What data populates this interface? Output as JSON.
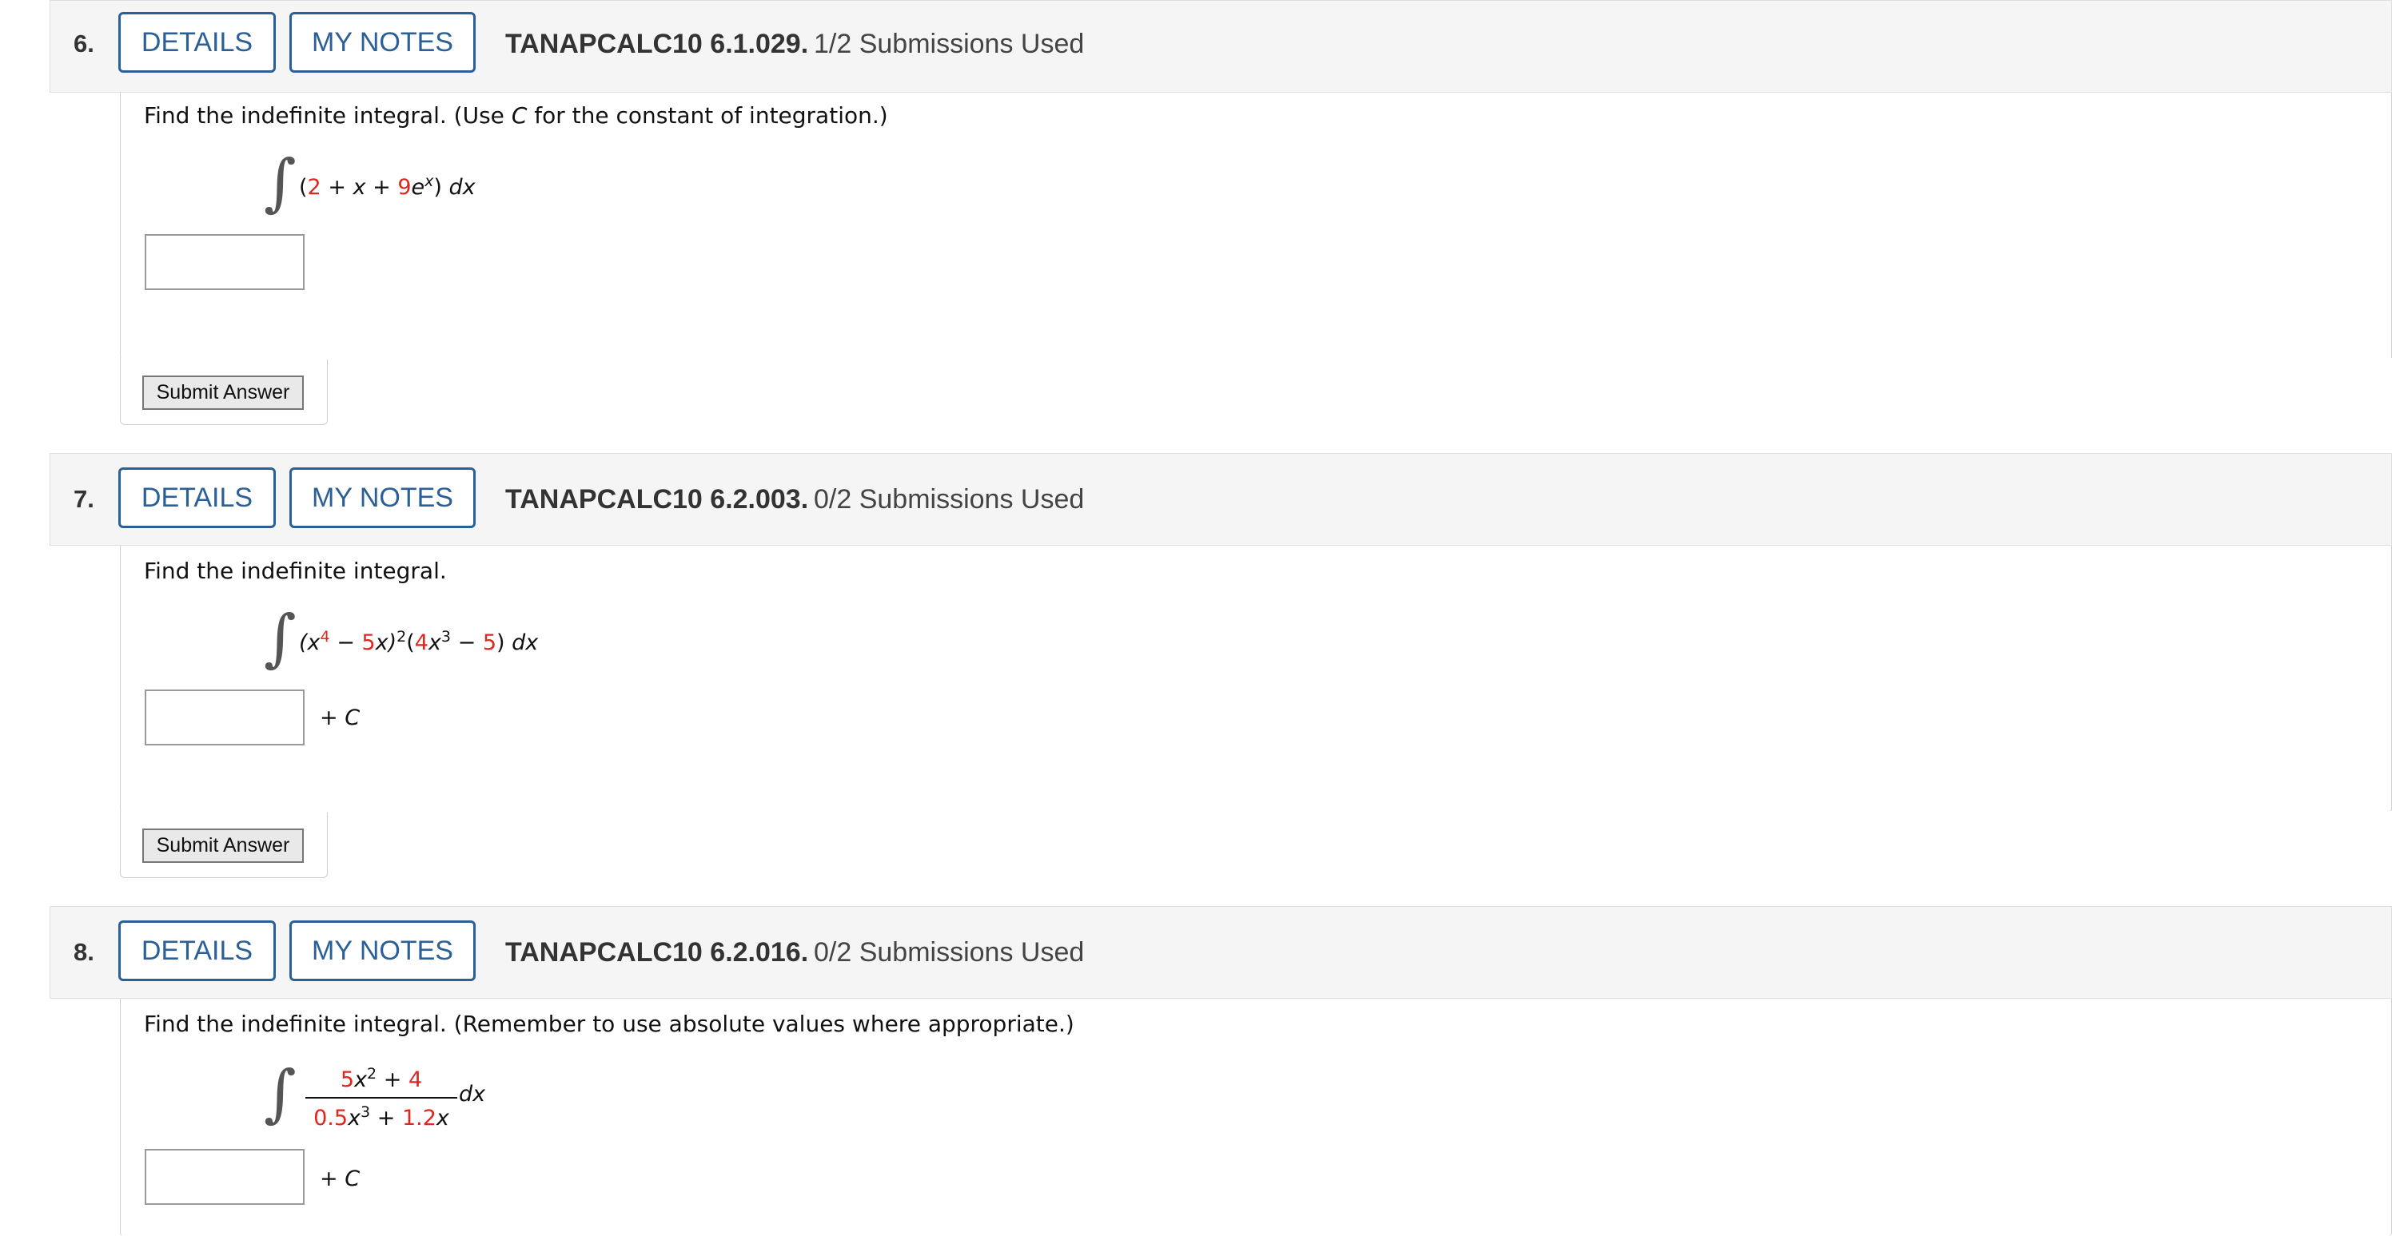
{
  "questions": [
    {
      "number": "6.",
      "details_label": "DETAILS",
      "notes_label": "MY NOTES",
      "problem_code": "TANAPCALC10 6.1.029.",
      "submissions": "1/2 Submissions Used",
      "prompt_before": "Find the indefinite integral. (Use ",
      "prompt_var": "C",
      "prompt_after": " for the constant of integration.)",
      "integral": {
        "open": "(",
        "t1": "2",
        "p1": " + ",
        "t2": "x",
        "p2": " + ",
        "t3": "9",
        "t4": "e",
        "exp": "x",
        "close": ")",
        "dx": "dx"
      },
      "submit_label": "Submit Answer"
    },
    {
      "number": "7.",
      "details_label": "DETAILS",
      "notes_label": "MY NOTES",
      "problem_code": "TANAPCALC10 6.2.003.",
      "submissions": "0/2 Submissions Used",
      "prompt": "Find the indefinite integral.",
      "integral": {
        "a": "(x",
        "a_exp": "4",
        "b": " − ",
        "c": "5",
        "d": "x)",
        "d_exp": "2",
        "e": "(",
        "f": "4",
        "g": "x",
        "g_exp": "3",
        "h": " − ",
        "i": "5",
        "j": ") ",
        "dx": "dx"
      },
      "plus_c": "+ C",
      "submit_label": "Submit Answer"
    },
    {
      "number": "8.",
      "details_label": "DETAILS",
      "notes_label": "MY NOTES",
      "problem_code": "TANAPCALC10 6.2.016.",
      "submissions": "0/2 Submissions Used",
      "prompt": "Find the indefinite integral. (Remember to use absolute values where appropriate.)",
      "integral": {
        "num_a": "5",
        "num_b": "x",
        "num_exp": "2",
        "num_c": " + ",
        "num_d": "4",
        "den_a": "0.5",
        "den_b": "x",
        "den_exp": "3",
        "den_c": " + ",
        "den_d": "1.2",
        "den_e": "x",
        "dx": "dx"
      },
      "plus_c": "+ C"
    }
  ]
}
